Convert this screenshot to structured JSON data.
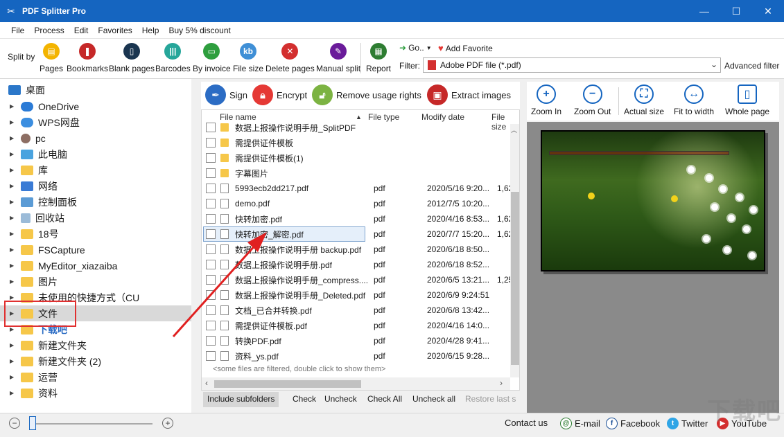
{
  "window": {
    "title": "PDF Splitter Pro",
    "minimize": "—",
    "maximize": "☐",
    "close": "✕"
  },
  "menu": [
    "File",
    "Process",
    "Edit",
    "Favorites",
    "Help",
    "Buy 5% discount"
  ],
  "toolbar": {
    "split_by": "Split by",
    "buttons": [
      {
        "label": "Pages",
        "color": "#f3b400"
      },
      {
        "label": "Bookmarks",
        "color": "#c62828"
      },
      {
        "label": "Blank pages",
        "color": "#1a3550"
      },
      {
        "label": "Barcodes",
        "color": "#26a69a"
      },
      {
        "label": "By invoice",
        "color": "#2e9e3e"
      },
      {
        "label": "File size",
        "color": "#3f8fd6"
      },
      {
        "label": "Delete pages",
        "color": "#d32f2f"
      },
      {
        "label": "Manual split",
        "color": "#6a1b9a"
      },
      {
        "label": "Report",
        "color": "#2e7d32"
      }
    ],
    "goto": "Go..",
    "add_favorite": "Add Favorite",
    "filter_label": "Filter:",
    "filter_value": "Adobe PDF file (*.pdf)",
    "advanced_filter": "Advanced filter"
  },
  "tree": {
    "root": "桌面",
    "items": [
      "OneDrive",
      "WPS网盘",
      "pc",
      "此电脑",
      "库",
      "网络",
      "控制面板",
      "回收站",
      "18号",
      "FSCapture",
      "MyEditor_xiazaiba",
      "图片",
      "未使用的快捷方式（CU",
      "文件",
      "下载吧",
      "新建文件夹",
      "新建文件夹 (2)",
      "运营",
      "资料"
    ]
  },
  "actions": [
    "Sign",
    "Encrypt",
    "Remove usage rights",
    "Extract images"
  ],
  "filelist": {
    "headers": {
      "name": "File name",
      "type": "File type",
      "date": "Modify date",
      "size": "File size"
    },
    "rows": [
      {
        "name": "数据上报操作说明手册_SplitPDF",
        "type": "",
        "date": "",
        "size": "",
        "kind": "folder"
      },
      {
        "name": "需提供证件模板",
        "type": "",
        "date": "",
        "size": "",
        "kind": "folder"
      },
      {
        "name": "需提供证件模板(1)",
        "type": "",
        "date": "",
        "size": "",
        "kind": "folder"
      },
      {
        "name": "字幕图片",
        "type": "",
        "date": "",
        "size": "",
        "kind": "folder"
      },
      {
        "name": "5993ecb2dd217.pdf",
        "type": "pdf",
        "date": "2020/5/16 9:20...",
        "size": "1,62",
        "kind": "doc"
      },
      {
        "name": "demo.pdf",
        "type": "pdf",
        "date": "2012/7/5 10:20...",
        "size": "",
        "kind": "doc"
      },
      {
        "name": "快转加密.pdf",
        "type": "pdf",
        "date": "2020/4/16 8:53...",
        "size": "1,62",
        "kind": "doc"
      },
      {
        "name": "快转加密_解密.pdf",
        "type": "pdf",
        "date": "2020/7/7 15:20...",
        "size": "1,62",
        "kind": "doc"
      },
      {
        "name": "数据上报操作说明手册 backup.pdf",
        "type": "pdf",
        "date": "2020/6/18 8:50...",
        "size": "",
        "kind": "doc"
      },
      {
        "name": "数据上报操作说明手册.pdf",
        "type": "pdf",
        "date": "2020/6/18 8:52...",
        "size": "",
        "kind": "doc"
      },
      {
        "name": "数据上报操作说明手册_compress....",
        "type": "pdf",
        "date": "2020/6/5 13:21...",
        "size": "1,25",
        "kind": "doc"
      },
      {
        "name": "数据上报操作说明手册_Deleted.pdf",
        "type": "pdf",
        "date": "2020/6/9 9:24:51",
        "size": "",
        "kind": "doc"
      },
      {
        "name": "文档_已合并转换.pdf",
        "type": "pdf",
        "date": "2020/6/8 13:42...",
        "size": "",
        "kind": "doc"
      },
      {
        "name": "需提供证件模板.pdf",
        "type": "pdf",
        "date": "2020/4/16 14:0...",
        "size": "",
        "kind": "doc"
      },
      {
        "name": "转换PDF.pdf",
        "type": "pdf",
        "date": "2020/4/28 9:41...",
        "size": "",
        "kind": "doc"
      },
      {
        "name": "资料_ys.pdf",
        "type": "pdf",
        "date": "2020/6/15 9:28...",
        "size": "",
        "kind": "doc"
      }
    ],
    "filtered_msg": "<some files are filtered, double click to show them>"
  },
  "bottom": [
    "Include subfolders",
    "Check",
    "Uncheck",
    "Check All",
    "Uncheck all",
    "Restore last s"
  ],
  "preview": [
    "Zoom In",
    "Zoom Out",
    "Actual size",
    "Fit to width",
    "Whole page"
  ],
  "status": {
    "contact": "Contact us",
    "email": "E-mail",
    "facebook": "Facebook",
    "twitter": "Twitter",
    "youtube": "YouTube"
  },
  "watermark": "下载吧"
}
